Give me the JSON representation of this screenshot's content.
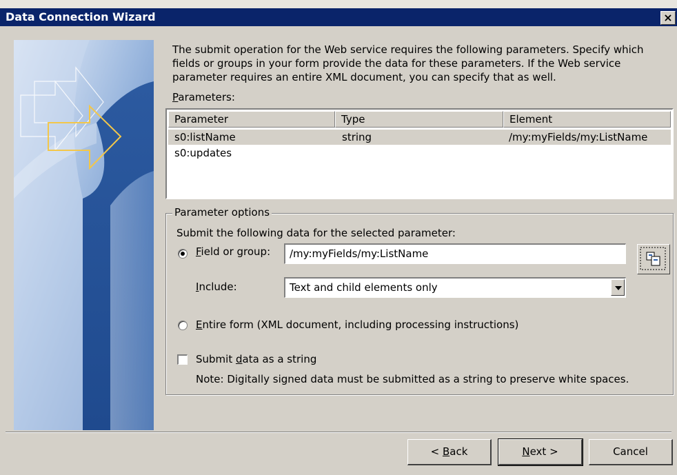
{
  "window": {
    "title": "Data Connection Wizard",
    "close_label": "×"
  },
  "intro": "The submit operation for the Web service requires the following parameters. Specify which fields or groups in your form provide the data for these parameters. If the Web service parameter requires an entire XML document, you can specify that as well.",
  "parameters": {
    "label": "Parameters:",
    "columns": [
      "Parameter",
      "Type",
      "Element"
    ],
    "rows": [
      {
        "parameter": "s0:listName",
        "type": "string",
        "element": "/my:myFields/my:ListName",
        "selected": true
      },
      {
        "parameter": "s0:updates",
        "type": "",
        "element": "",
        "selected": false
      }
    ]
  },
  "options": {
    "legend": "Parameter options",
    "instruction": "Submit the following data for the selected parameter:",
    "field_radio_label": "Field or group:",
    "field_value": "/my:myFields/my:ListName",
    "include_label": "Include:",
    "include_value": "Text and child elements only",
    "entire_form_label": "Entire form (XML document, including processing instructions)",
    "submit_string_label": "Submit data as a string",
    "note": "Note: Digitally signed data must be submitted as a string to preserve white spaces.",
    "field_selected": true,
    "submit_string_checked": false
  },
  "buttons": {
    "back": "< Back",
    "next": "Next >",
    "cancel": "Cancel"
  },
  "colors": {
    "titlebar": "#0a246a",
    "dialog": "#d4d0c8",
    "banner_blue": "#2f5fa8",
    "arrow_yellow": "#f3c74a"
  }
}
